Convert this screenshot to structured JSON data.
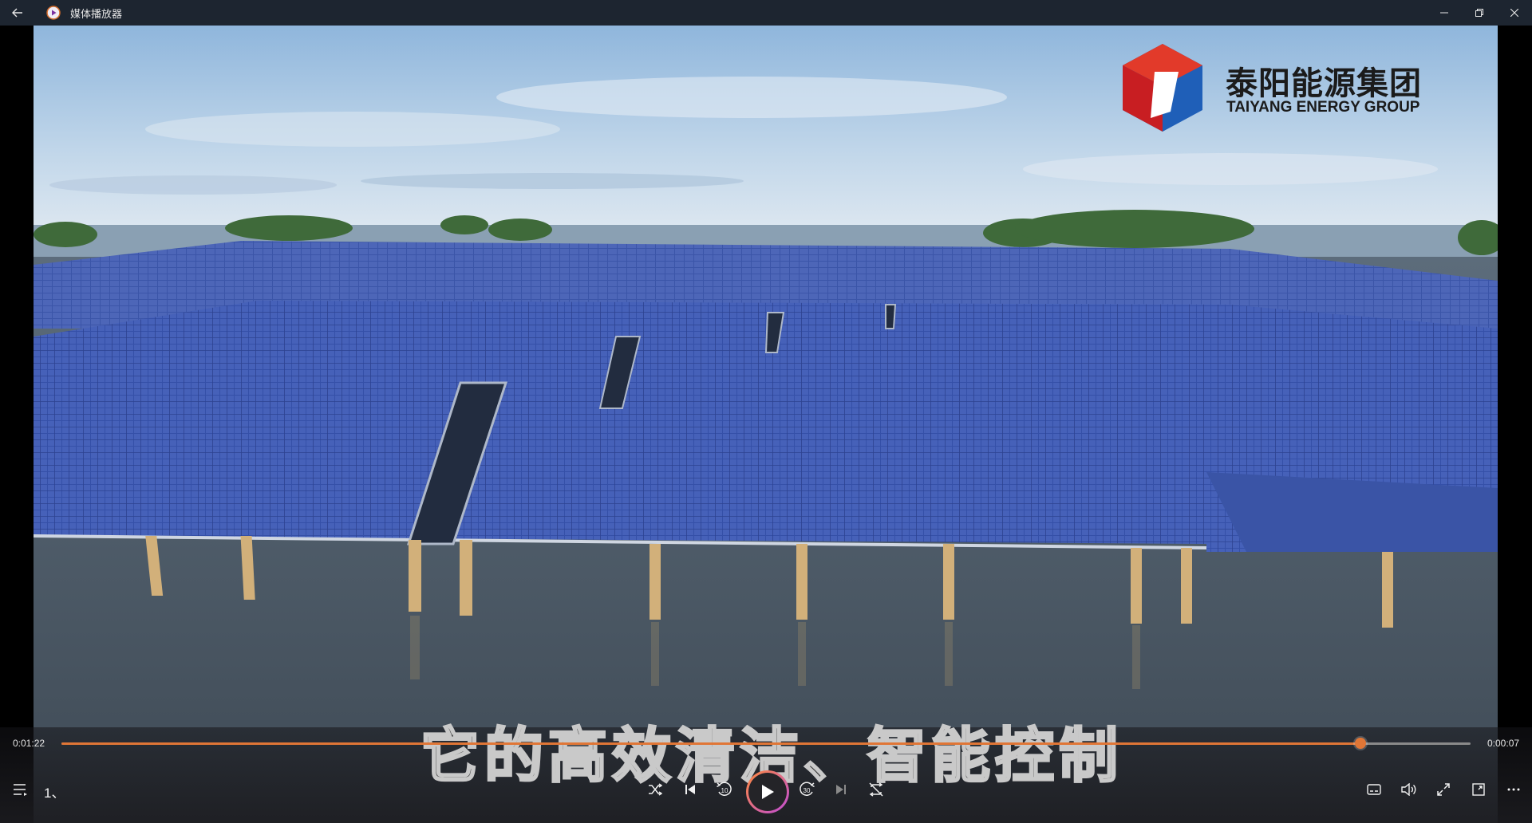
{
  "window": {
    "title": "媒体播放器",
    "back_icon": "back-arrow-icon",
    "app_icon": "media-player-icon",
    "minimize_icon": "minimize-icon",
    "restore_icon": "restore-icon",
    "close_icon": "close-icon"
  },
  "video": {
    "brand_name_cn": "泰阳能源集团",
    "brand_name_en": "TAIYANG ENERGY GROUP",
    "subtitle": "它的高效清洁、智能控制"
  },
  "playback": {
    "elapsed": "0:01:22",
    "remaining": "0:00:07",
    "progress_fraction": 0.922,
    "accent_color": "#e07636"
  },
  "controls": {
    "playlist_label": "1、",
    "left": [
      "playlist-icon"
    ],
    "center": [
      "shuffle-icon",
      "previous-icon",
      "rewind-10-icon",
      "play-icon",
      "forward-30-icon",
      "next-icon",
      "repeat-off-icon"
    ],
    "rewind_label": "10",
    "forward_label": "30",
    "right": [
      "captions-icon",
      "volume-icon",
      "fullscreen-icon",
      "mini-view-icon",
      "more-options-icon"
    ]
  }
}
